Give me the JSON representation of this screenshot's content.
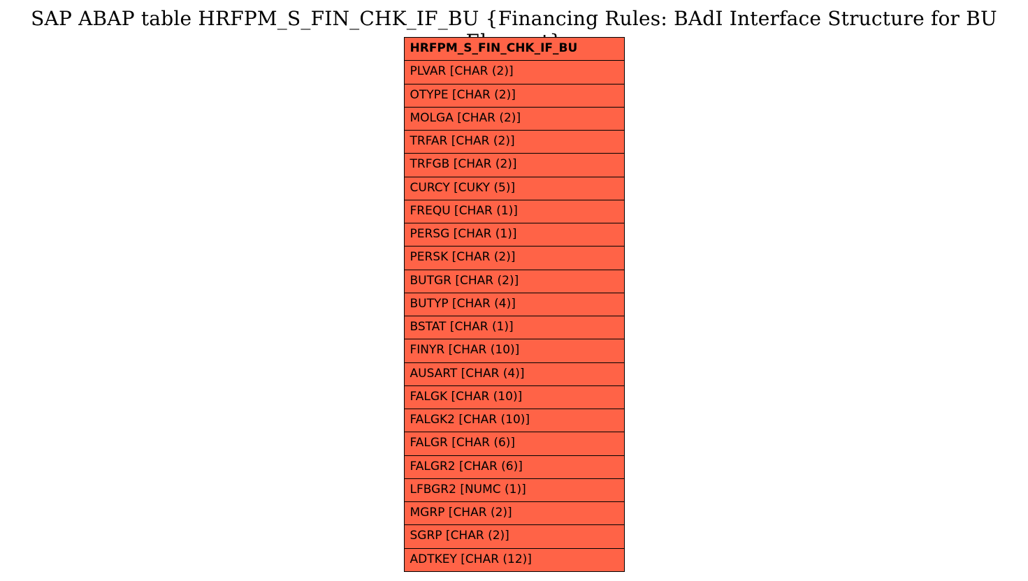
{
  "title": "SAP ABAP table HRFPM_S_FIN_CHK_IF_BU {Financing Rules: BAdI Interface Structure for BU Element}",
  "table": {
    "header": "HRFPM_S_FIN_CHK_IF_BU",
    "rows": [
      "PLVAR [CHAR (2)]",
      "OTYPE [CHAR (2)]",
      "MOLGA [CHAR (2)]",
      "TRFAR [CHAR (2)]",
      "TRFGB [CHAR (2)]",
      "CURCY [CUKY (5)]",
      "FREQU [CHAR (1)]",
      "PERSG [CHAR (1)]",
      "PERSK [CHAR (2)]",
      "BUTGR [CHAR (2)]",
      "BUTYP [CHAR (4)]",
      "BSTAT [CHAR (1)]",
      "FINYR [CHAR (10)]",
      "AUSART [CHAR (4)]",
      "FALGK [CHAR (10)]",
      "FALGK2 [CHAR (10)]",
      "FALGR [CHAR (6)]",
      "FALGR2 [CHAR (6)]",
      "LFBGR2 [NUMC (1)]",
      "MGRP [CHAR (2)]",
      "SGRP [CHAR (2)]",
      "ADTKEY [CHAR (12)]"
    ]
  }
}
